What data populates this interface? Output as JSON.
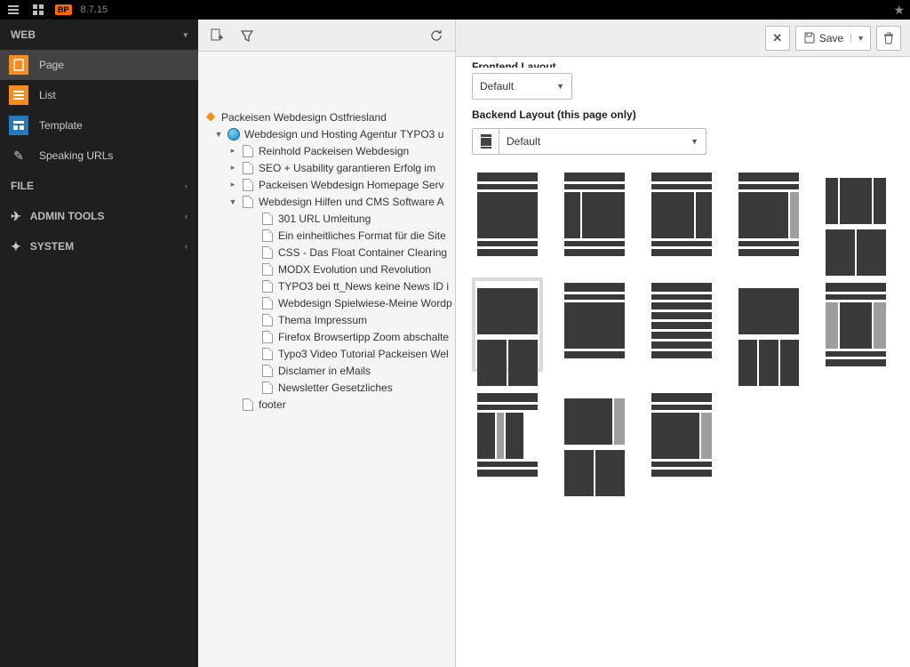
{
  "topbar": {
    "version": "8.7.15",
    "bp": "BP"
  },
  "sidebar": {
    "sections": [
      {
        "label": "WEB",
        "items": [
          {
            "label": "Page",
            "icon": "page",
            "active": true
          },
          {
            "label": "List",
            "icon": "list"
          },
          {
            "label": "Template",
            "icon": "template"
          },
          {
            "label": "Speaking URLs",
            "icon": "speaking"
          }
        ]
      },
      {
        "label": "FILE",
        "items": []
      },
      {
        "label": "ADMIN TOOLS",
        "items": []
      },
      {
        "label": "SYSTEM",
        "items": []
      }
    ]
  },
  "tree": {
    "root": "Packeisen Webdesign Ostfriesland",
    "site": "Webdesign und Hosting Agentur TYPO3 u",
    "pages": [
      "Reinhold Packeisen Webdesign",
      "SEO + Usability garantieren Erfolg im",
      "Packeisen Webdesign Homepage Serv",
      "Webdesign Hilfen und CMS Software A"
    ],
    "subpages": [
      "301 URL Umleitung",
      "Ein einheitliches Format für die Site",
      "CSS - Das Float Container Clearing",
      "MODX Evolution und Revolution",
      "TYPO3 bei tt_News keine News ID i",
      "Webdesign Spielwiese-Meine Wordp",
      "Thema Impressum",
      "Firefox Browsertipp Zoom abschalte",
      "Typo3 Video Tutorial Packeisen Wel",
      "Disclamer in eMails",
      "Newsletter Gesetzliches"
    ],
    "footer": "footer"
  },
  "doc": {
    "save": "Save",
    "frontend_label_cut": "Frontend Layout",
    "frontend_value": "Default",
    "backend_label": "Backend Layout (this page only)",
    "backend_value": "Default"
  }
}
